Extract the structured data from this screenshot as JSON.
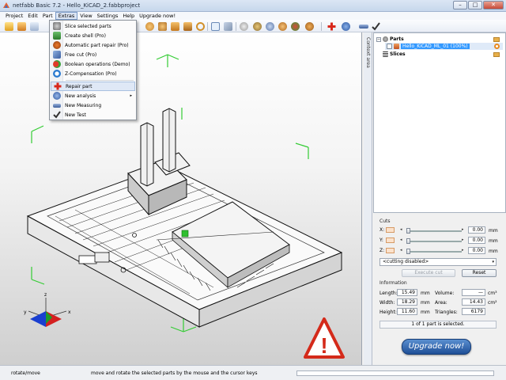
{
  "window": {
    "title": "netfabb Basic 7.2 - Hello_KiCAD_2.fabbproject",
    "minimize": "–",
    "maximize": "□",
    "close": "✕"
  },
  "menubar": {
    "items": [
      "Project",
      "Edit",
      "Part",
      "Extras",
      "View",
      "Settings",
      "Help",
      "Upgrade now!"
    ],
    "active": "Extras"
  },
  "extras_menu": {
    "items": [
      {
        "label": "Slice selected parts",
        "icon": "slice-icon"
      },
      {
        "label": "Create shell (Pro)",
        "icon": "shell-icon"
      },
      {
        "label": "Automatic part repair (Pro)",
        "icon": "auto-repair-icon"
      },
      {
        "label": "Free cut (Pro)",
        "icon": "free-cut-icon"
      },
      {
        "label": "Boolean operations (Demo)",
        "icon": "boolean-icon"
      },
      {
        "label": "Z-Compensation (Pro)",
        "icon": "z-compensation-icon"
      },
      {
        "label": "Repair part",
        "icon": "repair-cross-icon"
      },
      {
        "label": "New analysis",
        "icon": "analysis-icon",
        "submenu_arrow": "▸"
      },
      {
        "label": "New Measuring",
        "icon": "ruler-icon"
      },
      {
        "label": "New Test",
        "icon": "checkmark-icon"
      }
    ]
  },
  "context_tab": {
    "label": "Context area"
  },
  "tree": {
    "parts_label": "Parts",
    "part_item": "Hello_KiCAD_ML_01 (100%)",
    "slices_label": "Slices"
  },
  "cuts": {
    "title": "Cuts",
    "axes": [
      {
        "label": "X:",
        "value": "0.00",
        "unit": "mm",
        "left_arrow": "◂",
        "right_arrow": "▸"
      },
      {
        "label": "Y:",
        "value": "0.00",
        "unit": "mm",
        "left_arrow": "◂",
        "right_arrow": "▸"
      },
      {
        "label": "Z:",
        "value": "0.00",
        "unit": "mm",
        "left_arrow": "◂",
        "right_arrow": "▸"
      }
    ],
    "mode": "<cutting disabled>",
    "mode_caret": "▾",
    "execute_label": "Execute cut",
    "reset_label": "Reset"
  },
  "information": {
    "title": "Information",
    "length_label": "Length:",
    "length_value": "15.49",
    "length_unit": "mm",
    "width_label": "Width:",
    "width_value": "18.29",
    "width_unit": "mm",
    "height_label": "Height:",
    "height_value": "11.60",
    "height_unit": "mm",
    "volume_label": "Volume:",
    "volume_value": "—",
    "volume_unit": "cm³",
    "area_label": "Area:",
    "area_value": "14.43",
    "area_unit": "cm²",
    "triangles_label": "Triangles:",
    "triangles_value": "6179",
    "selection_status": "1 of 1 part is selected."
  },
  "upgrade": {
    "label": "Upgrade now!"
  },
  "axis_labels": {
    "x": "x",
    "y": "y",
    "z": "z"
  },
  "warning_glyph": "!",
  "statusbar": {
    "mode": "rotate/move",
    "hint": "move and rotate the selected parts by the mouse and the cursor keys"
  },
  "colors": {
    "accent_blue": "#1f4f97",
    "selection_blue": "#3399ff",
    "warning_red": "#d42a1a",
    "green_box": "#2fbf2f",
    "bbox_green": "#33cc33"
  }
}
